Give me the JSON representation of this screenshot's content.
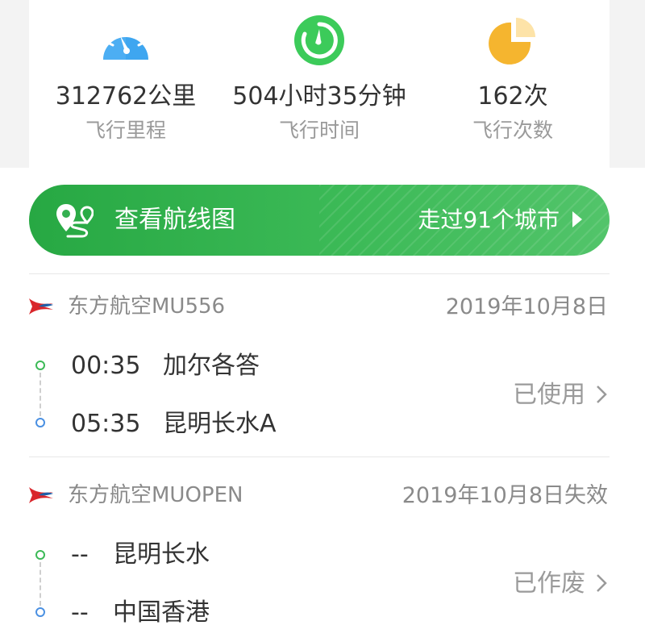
{
  "stats": [
    {
      "icon": "speedometer-icon",
      "value": "312762公里",
      "label": "飞行里程",
      "color": "#3ea6f0"
    },
    {
      "icon": "stopwatch-icon",
      "value": "504小时35分钟",
      "label": "飞行时间",
      "color": "#3ccb5a"
    },
    {
      "icon": "pie-chart-icon",
      "value": "162次",
      "label": "飞行次数",
      "color": "#f5b52f"
    }
  ],
  "route_banner": {
    "icon": "route-map-icon",
    "title": "查看航线图",
    "cities": "走过91个城市",
    "arrow_icon": "triangle-right-icon"
  },
  "flights": [
    {
      "airline_logo": "china-eastern-logo",
      "airline": "东方航空MU556",
      "date": "2019年10月8日",
      "depart_time": "00:35",
      "depart_place": "加尔各答",
      "arrive_time": "05:35",
      "arrive_place": "昆明长水A",
      "status": "已使用"
    },
    {
      "airline_logo": "china-eastern-logo",
      "airline": "东方航空MUOPEN",
      "date": "2019年10月8日失效",
      "depart_time": "--",
      "depart_place": "昆明长水",
      "arrive_time": "--",
      "arrive_place": "中国香港",
      "status": "已作废"
    }
  ],
  "colors": {
    "green": "#3cba57",
    "blue": "#4a90e2",
    "gray_text": "#9a9a9a",
    "airline_red": "#d9262b"
  }
}
